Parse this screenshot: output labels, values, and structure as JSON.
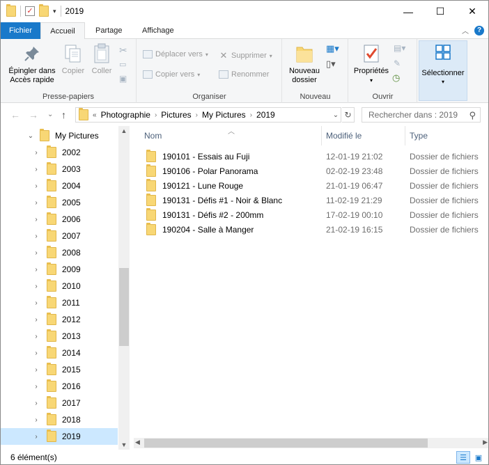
{
  "window": {
    "title": "2019",
    "controls": {
      "minimize": "—",
      "maximize": "☐",
      "close": "✕"
    }
  },
  "ribbon_tabs": [
    "Fichier",
    "Accueil",
    "Partage",
    "Affichage"
  ],
  "ribbon": {
    "presse_papiers": {
      "label": "Presse-papiers",
      "pin": "Épingler dans\nAccès rapide",
      "copy": "Copier",
      "paste": "Coller"
    },
    "organiser": {
      "label": "Organiser",
      "move_to": "Déplacer vers",
      "copy_to": "Copier vers",
      "delete": "Supprimer",
      "rename": "Renommer"
    },
    "nouveau": {
      "label": "Nouveau",
      "new_folder": "Nouveau\ndossier"
    },
    "ouvrir": {
      "label": "Ouvrir",
      "properties": "Propriétés"
    },
    "selectionner": {
      "label": "Sélectionner"
    }
  },
  "address": {
    "overflow": "«",
    "crumbs": [
      "Photographie",
      "Pictures",
      "My Pictures",
      "2019"
    ],
    "search_placeholder": "Rechercher dans : 2019"
  },
  "nav_tree": {
    "parent": "My Pictures",
    "children": [
      "2002",
      "2003",
      "2004",
      "2005",
      "2006",
      "2007",
      "2008",
      "2009",
      "2010",
      "2011",
      "2012",
      "2013",
      "2014",
      "2015",
      "2016",
      "2017",
      "2018",
      "2019"
    ],
    "selected": "2019"
  },
  "columns": {
    "name": "Nom",
    "modified": "Modifié le",
    "type": "Type"
  },
  "files": [
    {
      "name": "190101 - Essais au Fuji",
      "modified": "12-01-19 21:02",
      "type": "Dossier de fichiers"
    },
    {
      "name": "190106 - Polar Panorama",
      "modified": "02-02-19 23:48",
      "type": "Dossier de fichiers"
    },
    {
      "name": "190121 - Lune Rouge",
      "modified": "21-01-19 06:47",
      "type": "Dossier de fichiers"
    },
    {
      "name": "190131 - Défis #1 - Noir & Blanc",
      "modified": "11-02-19 21:29",
      "type": "Dossier de fichiers"
    },
    {
      "name": "190131 - Défis #2 - 200mm",
      "modified": "17-02-19 00:10",
      "type": "Dossier de fichiers"
    },
    {
      "name": "190204 - Salle à Manger",
      "modified": "21-02-19 16:15",
      "type": "Dossier de fichiers"
    }
  ],
  "status": {
    "count": "6 élément(s)"
  },
  "colors": {
    "accent": "#1979ca",
    "selection": "#cce8ff",
    "folder": "#f8d775"
  }
}
